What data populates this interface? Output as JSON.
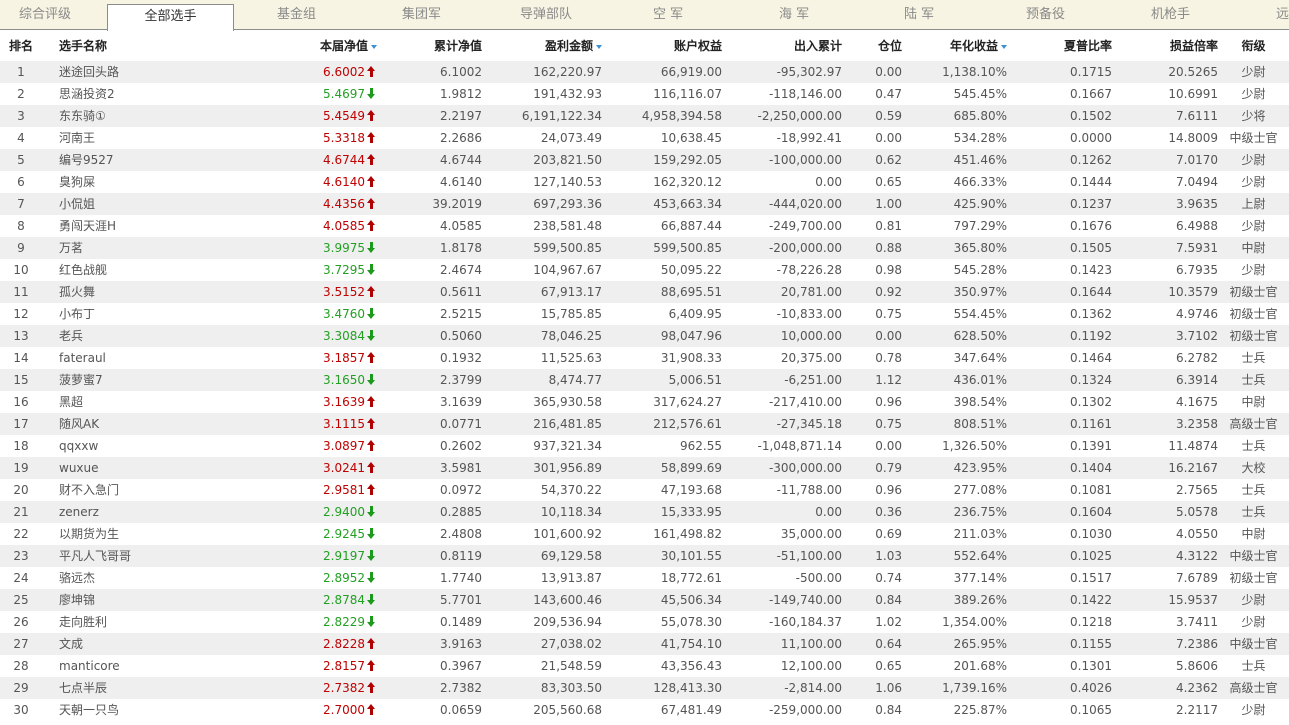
{
  "tabs": [
    "综合评级",
    "全部选手",
    "基金组",
    "集团军",
    "导弹部队",
    "空 军",
    "海 军",
    "陆 军",
    "预备役",
    "机枪手",
    "远"
  ],
  "active_tab": 1,
  "columns": {
    "rank": "排名",
    "name": "选手名称",
    "nav": "本届净值",
    "cum_nav": "累计净值",
    "pnl": "盈利金额",
    "equity": "账户权益",
    "flow": "出入累计",
    "position": "仓位",
    "annual": "年化收益",
    "sharpe": "夏普比率",
    "ratio": "损益倍率",
    "title": "衔级"
  },
  "sortable_columns": [
    "nav",
    "pnl",
    "annual"
  ],
  "rows": [
    {
      "rank": "1",
      "name": "迷途回头路",
      "nav": "6.6002",
      "dir": "up",
      "cum_nav": "6.1002",
      "pnl": "162,220.97",
      "equity": "66,919.00",
      "flow": "-95,302.97",
      "position": "0.00",
      "annual": "1,138.10%",
      "sharpe": "0.1715",
      "ratio": "20.5265",
      "title": "少尉"
    },
    {
      "rank": "2",
      "name": "思涵投资2",
      "nav": "5.4697",
      "dir": "down",
      "cum_nav": "1.9812",
      "pnl": "191,432.93",
      "equity": "116,116.07",
      "flow": "-118,146.00",
      "position": "0.47",
      "annual": "545.45%",
      "sharpe": "0.1667",
      "ratio": "10.6991",
      "title": "少尉"
    },
    {
      "rank": "3",
      "name": "东东骑①",
      "nav": "5.4549",
      "dir": "up",
      "cum_nav": "2.2197",
      "pnl": "6,191,122.34",
      "equity": "4,958,394.58",
      "flow": "-2,250,000.00",
      "position": "0.59",
      "annual": "685.80%",
      "sharpe": "0.1502",
      "ratio": "7.6111",
      "title": "少将"
    },
    {
      "rank": "4",
      "name": "河南王",
      "nav": "5.3318",
      "dir": "up",
      "cum_nav": "2.2686",
      "pnl": "24,073.49",
      "equity": "10,638.45",
      "flow": "-18,992.41",
      "position": "0.00",
      "annual": "534.28%",
      "sharpe": "0.0000",
      "ratio": "14.8009",
      "title": "中级士官"
    },
    {
      "rank": "5",
      "name": "编号9527",
      "nav": "4.6744",
      "dir": "up",
      "cum_nav": "4.6744",
      "pnl": "203,821.50",
      "equity": "159,292.05",
      "flow": "-100,000.00",
      "position": "0.62",
      "annual": "451.46%",
      "sharpe": "0.1262",
      "ratio": "7.0170",
      "title": "少尉"
    },
    {
      "rank": "6",
      "name": "臭狗屎",
      "nav": "4.6140",
      "dir": "up",
      "cum_nav": "4.6140",
      "pnl": "127,140.53",
      "equity": "162,320.12",
      "flow": "0.00",
      "position": "0.65",
      "annual": "466.33%",
      "sharpe": "0.1444",
      "ratio": "7.0494",
      "title": "少尉"
    },
    {
      "rank": "7",
      "name": "小侃姐",
      "nav": "4.4356",
      "dir": "up",
      "cum_nav": "39.2019",
      "pnl": "697,293.36",
      "equity": "453,663.34",
      "flow": "-444,020.00",
      "position": "1.00",
      "annual": "425.90%",
      "sharpe": "0.1237",
      "ratio": "3.9635",
      "title": "上尉"
    },
    {
      "rank": "8",
      "name": "勇闯天涯H",
      "nav": "4.0585",
      "dir": "up",
      "cum_nav": "4.0585",
      "pnl": "238,581.48",
      "equity": "66,887.44",
      "flow": "-249,700.00",
      "position": "0.81",
      "annual": "797.29%",
      "sharpe": "0.1676",
      "ratio": "6.4988",
      "title": "少尉"
    },
    {
      "rank": "9",
      "name": "万茗",
      "nav": "3.9975",
      "dir": "down",
      "cum_nav": "1.8178",
      "pnl": "599,500.85",
      "equity": "599,500.85",
      "flow": "-200,000.00",
      "position": "0.88",
      "annual": "365.80%",
      "sharpe": "0.1505",
      "ratio": "7.5931",
      "title": "中尉"
    },
    {
      "rank": "10",
      "name": "红色战舰",
      "nav": "3.7295",
      "dir": "down",
      "cum_nav": "2.4674",
      "pnl": "104,967.67",
      "equity": "50,095.22",
      "flow": "-78,226.28",
      "position": "0.98",
      "annual": "545.28%",
      "sharpe": "0.1423",
      "ratio": "6.7935",
      "title": "少尉"
    },
    {
      "rank": "11",
      "name": "孤火舞",
      "nav": "3.5152",
      "dir": "up",
      "cum_nav": "0.5611",
      "pnl": "67,913.17",
      "equity": "88,695.51",
      "flow": "20,781.00",
      "position": "0.92",
      "annual": "350.97%",
      "sharpe": "0.1644",
      "ratio": "10.3579",
      "title": "初级士官"
    },
    {
      "rank": "12",
      "name": "小布丁",
      "nav": "3.4760",
      "dir": "down",
      "cum_nav": "2.5215",
      "pnl": "15,785.85",
      "equity": "6,409.95",
      "flow": "-10,833.00",
      "position": "0.75",
      "annual": "554.45%",
      "sharpe": "0.1362",
      "ratio": "4.9746",
      "title": "初级士官"
    },
    {
      "rank": "13",
      "name": "老兵",
      "nav": "3.3084",
      "dir": "down",
      "cum_nav": "0.5060",
      "pnl": "78,046.25",
      "equity": "98,047.96",
      "flow": "10,000.00",
      "position": "0.00",
      "annual": "628.50%",
      "sharpe": "0.1192",
      "ratio": "3.7102",
      "title": "初级士官"
    },
    {
      "rank": "14",
      "name": "fateraul",
      "nav": "3.1857",
      "dir": "up",
      "cum_nav": "0.1932",
      "pnl": "11,525.63",
      "equity": "31,908.33",
      "flow": "20,375.00",
      "position": "0.78",
      "annual": "347.64%",
      "sharpe": "0.1464",
      "ratio": "6.2782",
      "title": "士兵"
    },
    {
      "rank": "15",
      "name": "菠萝蜜7",
      "nav": "3.1650",
      "dir": "down",
      "cum_nav": "2.3799",
      "pnl": "8,474.77",
      "equity": "5,006.51",
      "flow": "-6,251.00",
      "position": "1.12",
      "annual": "436.01%",
      "sharpe": "0.1324",
      "ratio": "6.3914",
      "title": "士兵"
    },
    {
      "rank": "16",
      "name": "黑超",
      "nav": "3.1639",
      "dir": "up",
      "cum_nav": "3.1639",
      "pnl": "365,930.58",
      "equity": "317,624.27",
      "flow": "-217,410.00",
      "position": "0.96",
      "annual": "398.54%",
      "sharpe": "0.1302",
      "ratio": "4.1675",
      "title": "中尉"
    },
    {
      "rank": "17",
      "name": "随风AK",
      "nav": "3.1115",
      "dir": "up",
      "cum_nav": "0.0771",
      "pnl": "216,481.85",
      "equity": "212,576.61",
      "flow": "-27,345.18",
      "position": "0.75",
      "annual": "808.51%",
      "sharpe": "0.1161",
      "ratio": "3.2358",
      "title": "高级士官"
    },
    {
      "rank": "18",
      "name": "qqxxw",
      "nav": "3.0897",
      "dir": "up",
      "cum_nav": "0.2602",
      "pnl": "937,321.34",
      "equity": "962.55",
      "flow": "-1,048,871.14",
      "position": "0.00",
      "annual": "1,326.50%",
      "sharpe": "0.1391",
      "ratio": "11.4874",
      "title": "士兵"
    },
    {
      "rank": "19",
      "name": "wuxue",
      "nav": "3.0241",
      "dir": "up",
      "cum_nav": "3.5981",
      "pnl": "301,956.89",
      "equity": "58,899.69",
      "flow": "-300,000.00",
      "position": "0.79",
      "annual": "423.95%",
      "sharpe": "0.1404",
      "ratio": "16.2167",
      "title": "大校"
    },
    {
      "rank": "20",
      "name": "财不入急门",
      "nav": "2.9581",
      "dir": "up",
      "cum_nav": "0.0972",
      "pnl": "54,370.22",
      "equity": "47,193.68",
      "flow": "-11,788.00",
      "position": "0.96",
      "annual": "277.08%",
      "sharpe": "0.1081",
      "ratio": "2.7565",
      "title": "士兵"
    },
    {
      "rank": "21",
      "name": "zenerz",
      "nav": "2.9400",
      "dir": "down",
      "cum_nav": "0.2885",
      "pnl": "10,118.34",
      "equity": "15,333.95",
      "flow": "0.00",
      "position": "0.36",
      "annual": "236.75%",
      "sharpe": "0.1604",
      "ratio": "5.0578",
      "title": "士兵"
    },
    {
      "rank": "22",
      "name": "以期货为生",
      "nav": "2.9245",
      "dir": "down",
      "cum_nav": "2.4808",
      "pnl": "101,600.92",
      "equity": "161,498.82",
      "flow": "35,000.00",
      "position": "0.69",
      "annual": "211.03%",
      "sharpe": "0.1030",
      "ratio": "4.0550",
      "title": "中尉"
    },
    {
      "rank": "23",
      "name": "平凡人飞哥哥",
      "nav": "2.9197",
      "dir": "down",
      "cum_nav": "0.8119",
      "pnl": "69,129.58",
      "equity": "30,101.55",
      "flow": "-51,100.00",
      "position": "1.03",
      "annual": "552.64%",
      "sharpe": "0.1025",
      "ratio": "4.3122",
      "title": "中级士官"
    },
    {
      "rank": "24",
      "name": "骆远杰",
      "nav": "2.8952",
      "dir": "down",
      "cum_nav": "1.7740",
      "pnl": "13,913.87",
      "equity": "18,772.61",
      "flow": "-500.00",
      "position": "0.74",
      "annual": "377.14%",
      "sharpe": "0.1517",
      "ratio": "7.6789",
      "title": "初级士官"
    },
    {
      "rank": "25",
      "name": "廖坤锦",
      "nav": "2.8784",
      "dir": "down",
      "cum_nav": "5.7701",
      "pnl": "143,600.46",
      "equity": "45,506.34",
      "flow": "-149,740.00",
      "position": "0.84",
      "annual": "389.26%",
      "sharpe": "0.1422",
      "ratio": "15.9537",
      "title": "少尉"
    },
    {
      "rank": "26",
      "name": "走向胜利",
      "nav": "2.8229",
      "dir": "down",
      "cum_nav": "0.1489",
      "pnl": "209,536.94",
      "equity": "55,078.30",
      "flow": "-160,184.37",
      "position": "1.02",
      "annual": "1,354.00%",
      "sharpe": "0.1218",
      "ratio": "3.7411",
      "title": "少尉"
    },
    {
      "rank": "27",
      "name": "文成",
      "nav": "2.8228",
      "dir": "up",
      "cum_nav": "3.9163",
      "pnl": "27,038.02",
      "equity": "41,754.10",
      "flow": "11,100.00",
      "position": "0.64",
      "annual": "265.95%",
      "sharpe": "0.1155",
      "ratio": "7.2386",
      "title": "中级士官"
    },
    {
      "rank": "28",
      "name": "manticore",
      "nav": "2.8157",
      "dir": "up",
      "cum_nav": "0.3967",
      "pnl": "21,548.59",
      "equity": "43,356.43",
      "flow": "12,100.00",
      "position": "0.65",
      "annual": "201.68%",
      "sharpe": "0.1301",
      "ratio": "5.8606",
      "title": "士兵"
    },
    {
      "rank": "29",
      "name": "七点半辰",
      "nav": "2.7382",
      "dir": "up",
      "cum_nav": "2.7382",
      "pnl": "83,303.50",
      "equity": "128,413.30",
      "flow": "-2,814.00",
      "position": "1.06",
      "annual": "1,739.16%",
      "sharpe": "0.4026",
      "ratio": "4.2362",
      "title": "高级士官"
    },
    {
      "rank": "30",
      "name": "天朝一只鸟",
      "nav": "2.7000",
      "dir": "up",
      "cum_nav": "0.0659",
      "pnl": "205,560.68",
      "equity": "67,481.49",
      "flow": "-259,000.00",
      "position": "0.84",
      "annual": "225.87%",
      "sharpe": "0.1065",
      "ratio": "2.2117",
      "title": "少尉"
    }
  ]
}
